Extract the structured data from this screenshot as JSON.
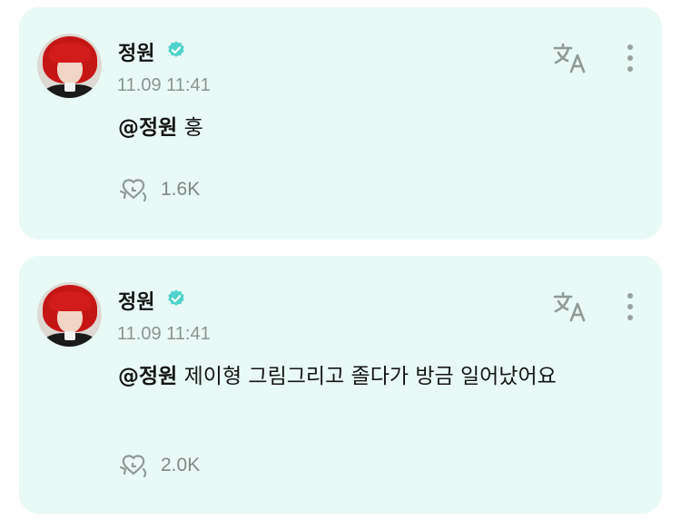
{
  "posts": [
    {
      "author": "정원",
      "verified": true,
      "time": "11.09 11:41",
      "mention": "@정원",
      "text": "훙",
      "reactions": "1.6K"
    },
    {
      "author": "정원",
      "verified": true,
      "time": "11.09 11:41",
      "mention": "@정원",
      "text": "제이형 그림그리고 졸다가 방금 일어났어요",
      "reactions": "2.0K"
    }
  ],
  "colors": {
    "card_background": "#e9f9f6",
    "verified_badge": "#4fd2cc",
    "muted_text": "#8a9591"
  },
  "icons": {
    "translate": "translate-icon",
    "more": "more-vertical-icon",
    "reaction": "reaction-heart-icon",
    "verified": "verified-badge-icon"
  }
}
